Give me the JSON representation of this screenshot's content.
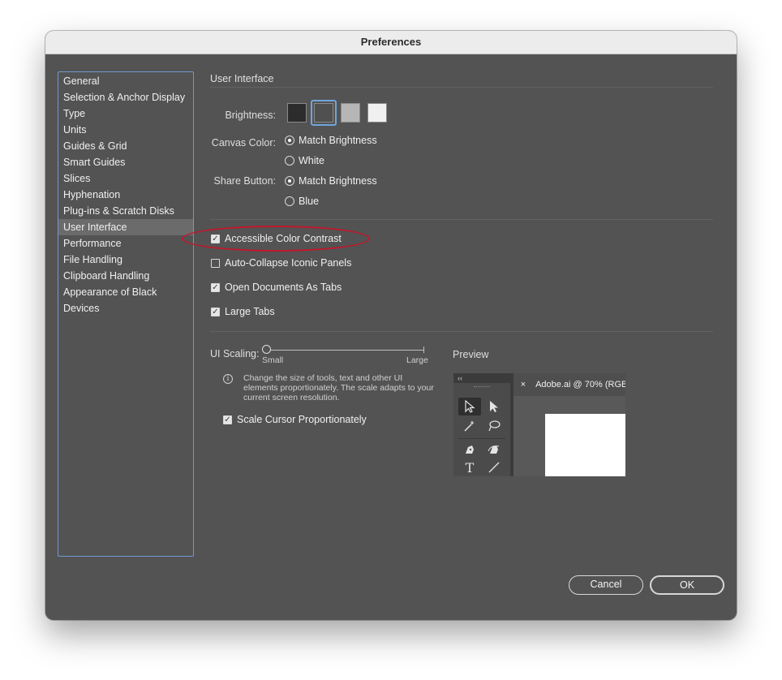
{
  "window": {
    "title": "Preferences"
  },
  "sidebar": {
    "items": [
      {
        "label": "General"
      },
      {
        "label": "Selection & Anchor Display"
      },
      {
        "label": "Type"
      },
      {
        "label": "Units"
      },
      {
        "label": "Guides & Grid"
      },
      {
        "label": "Smart Guides"
      },
      {
        "label": "Slices"
      },
      {
        "label": "Hyphenation"
      },
      {
        "label": "Plug-ins & Scratch Disks"
      },
      {
        "label": "User Interface"
      },
      {
        "label": "Performance"
      },
      {
        "label": "File Handling"
      },
      {
        "label": "Clipboard Handling"
      },
      {
        "label": "Appearance of Black"
      },
      {
        "label": "Devices"
      }
    ],
    "selected": "User Interface"
  },
  "main": {
    "section_title": "User Interface",
    "brightness": {
      "label": "Brightness:",
      "swatches": [
        "#2c2c2c",
        "#505050",
        "#b6b6b6",
        "#f0f0f0"
      ],
      "selected_index": 1
    },
    "canvas_color": {
      "label": "Canvas Color:",
      "options": [
        "Match Brightness",
        "White"
      ],
      "selected": "Match Brightness"
    },
    "share_button": {
      "label": "Share Button:",
      "options": [
        "Match Brightness",
        "Blue"
      ],
      "selected": "Match Brightness"
    },
    "checkboxes": [
      {
        "label": "Accessible Color Contrast",
        "checked": true
      },
      {
        "label": "Auto-Collapse Iconic Panels",
        "checked": false
      },
      {
        "label": "Open Documents As Tabs",
        "checked": true
      },
      {
        "label": "Large Tabs",
        "checked": true
      }
    ],
    "ui_scaling": {
      "label": "UI Scaling:",
      "min_label": "Small",
      "max_label": "Large",
      "value": 0,
      "info_icon": "i",
      "info_text": "Change the size of tools, text and other UI elements proportionately. The scale adapts to your current screen resolution."
    },
    "scale_cursor": {
      "label": "Scale Cursor Proportionately",
      "checked": true
    },
    "preview": {
      "label": "Preview",
      "collapse_glyph": "‹‹",
      "tab_close": "×",
      "tab_title": "Adobe.ai @ 70% (RGB/"
    }
  },
  "buttons": {
    "cancel": "Cancel",
    "ok": "OK"
  },
  "annotation_color": "#c2172b"
}
